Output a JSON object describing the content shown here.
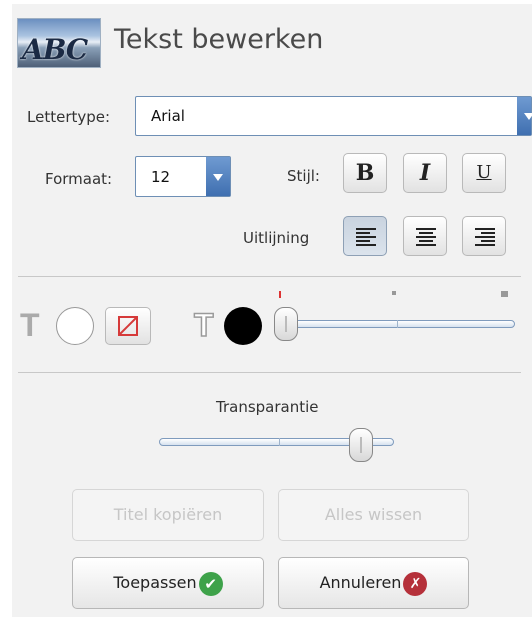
{
  "header": {
    "logo_text": "ABC",
    "title": "Tekst bewerken"
  },
  "font": {
    "label": "Lettertype:",
    "value": "Arial"
  },
  "size": {
    "label": "Formaat:",
    "value": "12"
  },
  "style": {
    "label": "Stijl:",
    "bold": "B",
    "italic": "I",
    "underline": "U"
  },
  "alignment": {
    "label": "Uitlijning",
    "selected": "left"
  },
  "colors": {
    "text_fill": "#ffffff",
    "outline_fill": "#000000",
    "accent": "#3f6fb0"
  },
  "transparency": {
    "label": "Transparantie",
    "level_percent": 90
  },
  "outline_width_level_percent": 0,
  "buttons": {
    "copy_title": "Titel kopiëren",
    "clear_all": "Alles wissen",
    "apply": "Toepassen",
    "cancel": "Annuleren"
  }
}
